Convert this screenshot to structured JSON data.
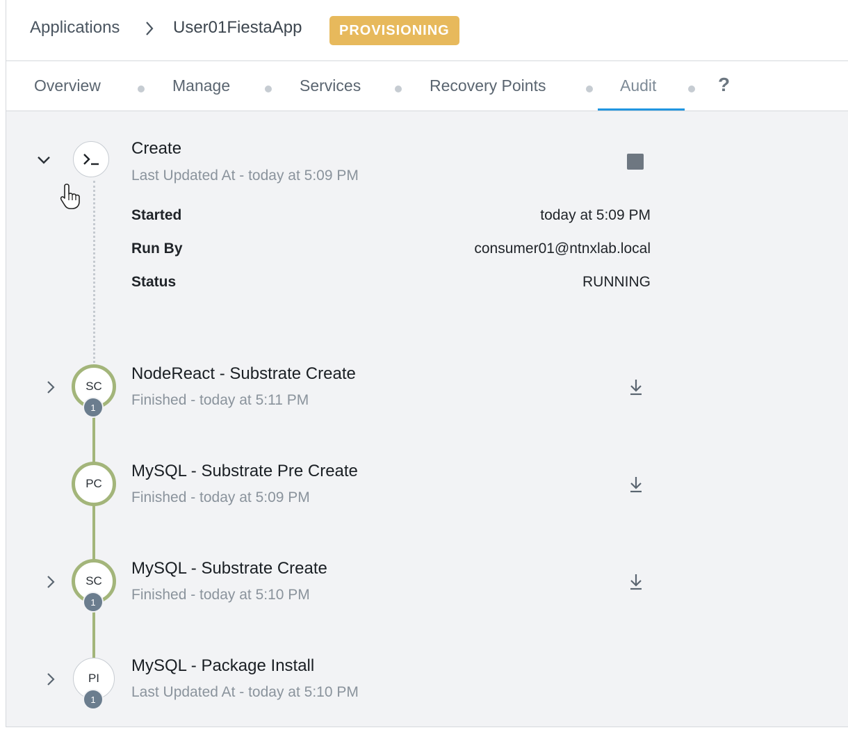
{
  "breadcrumb": {
    "root": "Applications",
    "app": "User01FiestaApp",
    "status_badge": "PROVISIONING"
  },
  "tabs": [
    {
      "label": "Overview"
    },
    {
      "label": "Manage"
    },
    {
      "label": "Services"
    },
    {
      "label": "Recovery Points"
    },
    {
      "label": "Audit",
      "active": true
    }
  ],
  "help_label": "?",
  "colors": {
    "badge": "#e7b95c",
    "active_tab_underline": "#2196e0",
    "completed_node": "#a3b57a",
    "count_badge": "#6b7d8e"
  },
  "audit": {
    "create": {
      "title": "Create",
      "subtitle": "Last Updated At - today at 5:09 PM",
      "details": [
        {
          "label": "Started",
          "value": "today at 5:09 PM"
        },
        {
          "label": "Run By",
          "value": "consumer01@ntnxlab.local"
        },
        {
          "label": "Status",
          "value": "RUNNING"
        }
      ]
    },
    "tasks": [
      {
        "code": "SC",
        "count": "1",
        "title": "NodeReact - Substrate Create",
        "subtitle": "Finished - today at 5:11 PM"
      },
      {
        "code": "PC",
        "title": "MySQL - Substrate Pre Create",
        "subtitle": "Finished - today at 5:09 PM"
      },
      {
        "code": "SC",
        "count": "1",
        "title": "MySQL - Substrate Create",
        "subtitle": "Finished - today at 5:10 PM"
      },
      {
        "code": "PI",
        "count": "1",
        "title": "MySQL - Package Install",
        "subtitle": "Last Updated At - today at 5:10 PM"
      }
    ]
  }
}
